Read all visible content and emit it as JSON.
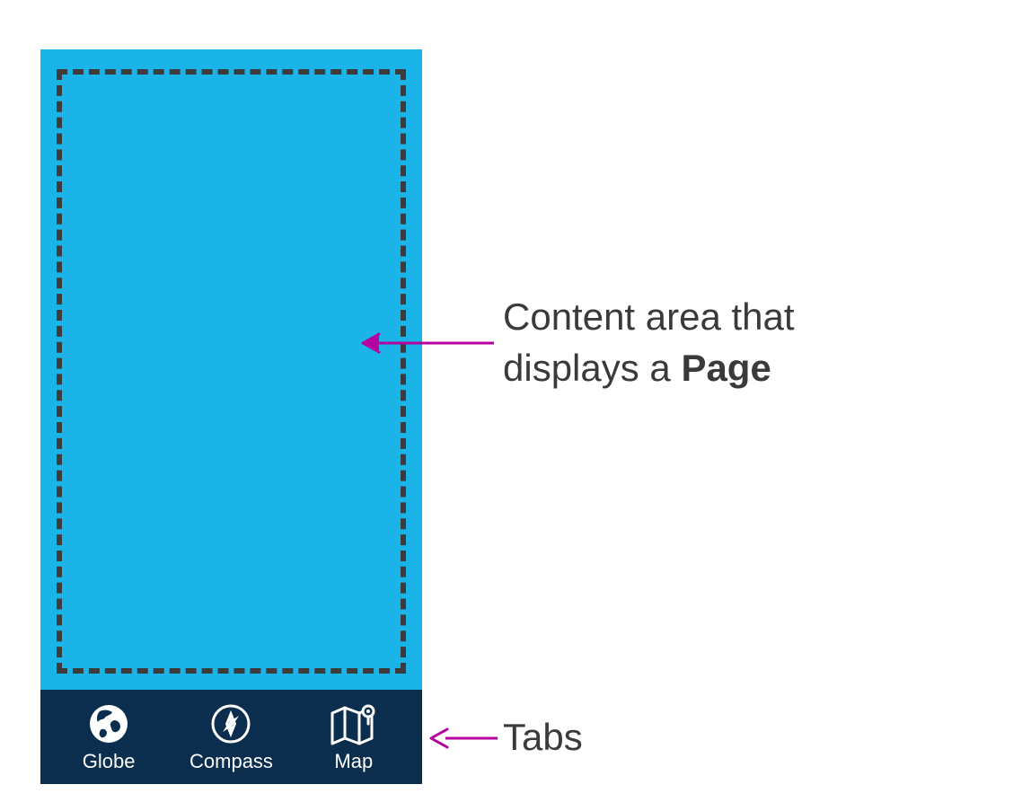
{
  "annotations": {
    "content_line1": "Content area that",
    "content_line2a": "displays a ",
    "content_line2b": "Page",
    "tabs": "Tabs"
  },
  "tabs": [
    {
      "label": "Globe",
      "icon": "globe-icon"
    },
    {
      "label": "Compass",
      "icon": "compass-icon"
    },
    {
      "label": "Map",
      "icon": "map-icon"
    }
  ],
  "colors": {
    "content_bg": "#1BB4E8",
    "tabbar_bg": "#0B2E4E",
    "dash": "#3C3C3C",
    "arrow": "#B4009E"
  }
}
